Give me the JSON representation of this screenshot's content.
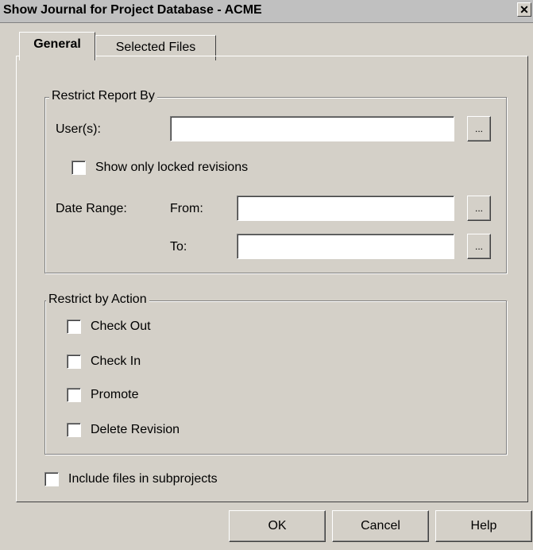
{
  "window": {
    "title": "Show Journal for Project Database - ACME",
    "close_glyph": "✕"
  },
  "tabs": [
    {
      "label": "General",
      "active": true
    },
    {
      "label": "Selected Files",
      "active": false
    }
  ],
  "restrict_report": {
    "legend": "Restrict Report By",
    "users_label": "User(s):",
    "users_value": "",
    "browse_label": "...",
    "locked_label": "Show only locked revisions",
    "locked_checked": false,
    "date_range_label": "Date Range:",
    "from_label": "From:",
    "from_value": "",
    "to_label": "To:",
    "to_value": ""
  },
  "restrict_action": {
    "legend": "Restrict by Action",
    "items": [
      {
        "label": "Check Out",
        "checked": false
      },
      {
        "label": "Check In",
        "checked": false
      },
      {
        "label": "Promote",
        "checked": false
      },
      {
        "label": "Delete Revision",
        "checked": false
      }
    ]
  },
  "include_subprojects": {
    "label": "Include files in subprojects",
    "checked": false
  },
  "buttons": {
    "ok": "OK",
    "cancel": "Cancel",
    "help": "Help"
  },
  "icons": {
    "close": "close-icon",
    "checkbox": "checkbox-icon"
  }
}
